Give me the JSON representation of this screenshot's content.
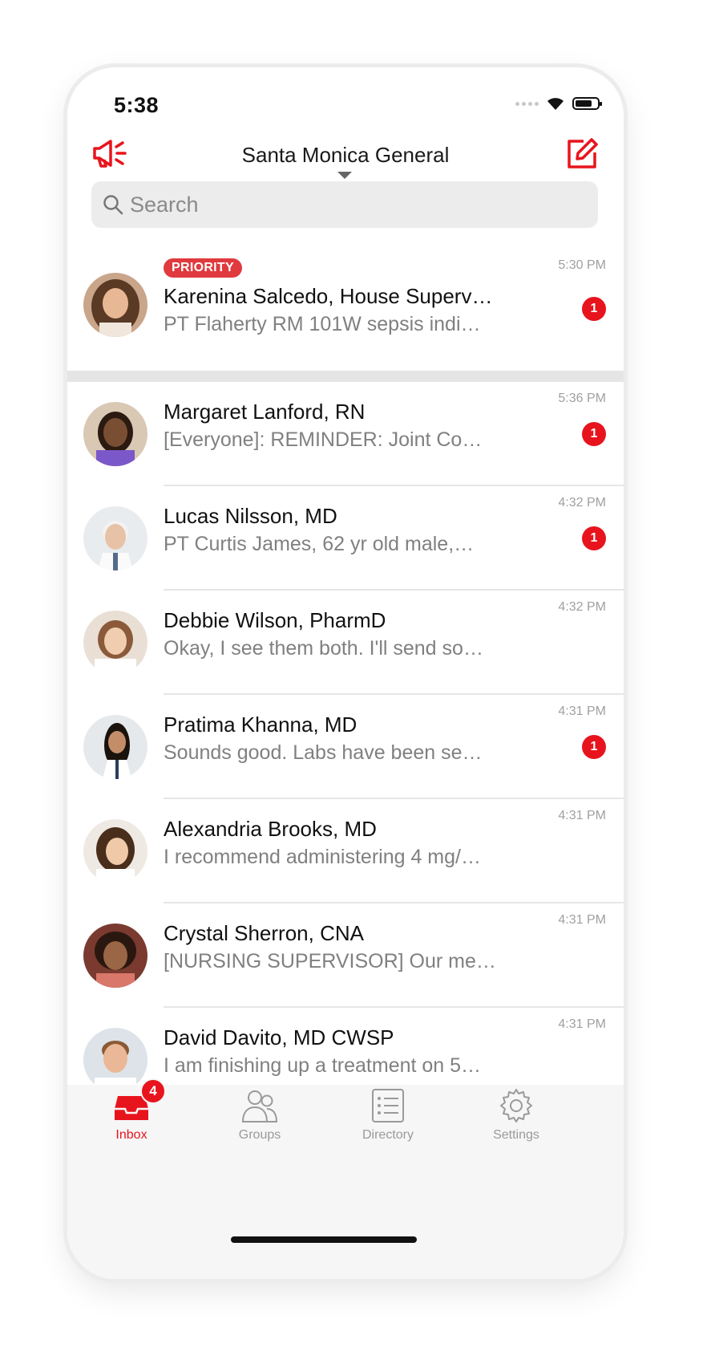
{
  "status_bar": {
    "time": "5:38"
  },
  "header": {
    "title": "Santa Monica General",
    "left_icon": "megaphone-icon",
    "right_icon": "compose-icon"
  },
  "search": {
    "placeholder": "Search",
    "value": ""
  },
  "priority_label": "PRIORITY",
  "priority_conversations": [
    {
      "name": "Karenina Salcedo, House Superv…",
      "preview": "PT Flaherty RM 101W sepsis indi…",
      "time": "5:30 PM",
      "unread": "1"
    }
  ],
  "conversations": [
    {
      "name": "Margaret Lanford, RN",
      "preview": "[Everyone]: REMINDER: Joint Co…",
      "time": "5:36 PM",
      "unread": "1"
    },
    {
      "name": "Lucas Nilsson, MD",
      "preview": "PT Curtis James, 62 yr old male,…",
      "time": "4:32 PM",
      "unread": "1"
    },
    {
      "name": "Debbie Wilson, PharmD",
      "preview": "Okay, I see them both. I'll send so…",
      "time": "4:32 PM",
      "unread": ""
    },
    {
      "name": "Pratima Khanna, MD",
      "preview": "Sounds good. Labs have been se…",
      "time": "4:31 PM",
      "unread": "1"
    },
    {
      "name": "Alexandria Brooks, MD",
      "preview": "I recommend administering 4 mg/…",
      "time": "4:31 PM",
      "unread": ""
    },
    {
      "name": "Crystal Sherron, CNA",
      "preview": "[NURSING SUPERVISOR] Our me…",
      "time": "4:31 PM",
      "unread": ""
    },
    {
      "name": "David Davito, MD CWSP",
      "preview": "I am finishing up a treatment on 5…",
      "time": "4:31 PM",
      "unread": ""
    }
  ],
  "tabs": [
    {
      "label": "Inbox",
      "icon": "inbox-icon",
      "badge": "4",
      "active": true
    },
    {
      "label": "Groups",
      "icon": "groups-icon",
      "badge": "",
      "active": false
    },
    {
      "label": "Directory",
      "icon": "directory-icon",
      "badge": "",
      "active": false
    },
    {
      "label": "Settings",
      "icon": "gear-icon",
      "badge": "",
      "active": false
    }
  ],
  "colors": {
    "accent": "#e8141d",
    "priority_badge": "#e03a3e",
    "muted_text": "#808080"
  }
}
